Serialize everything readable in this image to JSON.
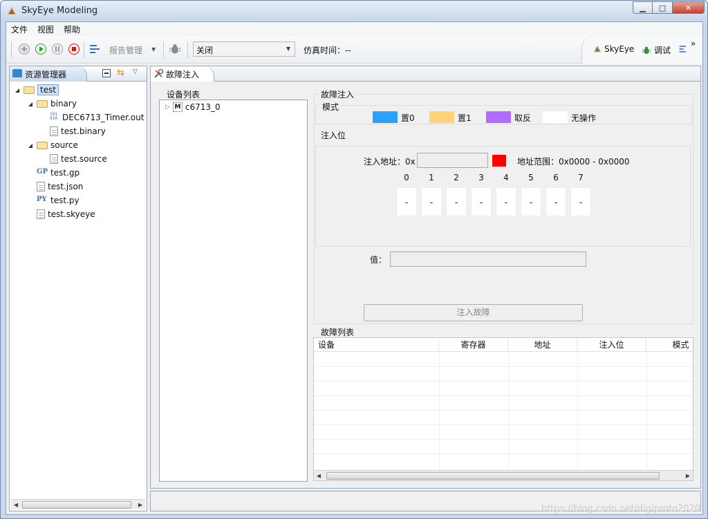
{
  "window": {
    "title": "SkyEye Modeling",
    "buttons": {
      "minimize": "▁",
      "maximize": "□",
      "close": "✕"
    }
  },
  "menu": [
    "文件",
    "视图",
    "帮助"
  ],
  "toolbar": {
    "report_label": "报告管理",
    "combo_value": "关闭",
    "sim_time_label": "仿真时间：--",
    "perspectives": {
      "skyeye": "SkyEye",
      "debug": "调试",
      "more": "»"
    }
  },
  "explorer": {
    "tab_label": "资源管理器",
    "tree": [
      {
        "label": "test",
        "depth": 0,
        "twisty": "◢",
        "icon": "folder-open-icon"
      },
      {
        "label": "binary",
        "depth": 1,
        "twisty": "◢",
        "icon": "folder-open-icon"
      },
      {
        "label": "DEC6713_Timer.out",
        "depth": 2,
        "twisty": "",
        "icon": "binary-file-icon"
      },
      {
        "label": "test.binary",
        "depth": 2,
        "twisty": "",
        "icon": "file-icon"
      },
      {
        "label": "source",
        "depth": 1,
        "twisty": "◢",
        "icon": "folder-open-icon"
      },
      {
        "label": "test.source",
        "depth": 2,
        "twisty": "",
        "icon": "file-icon"
      },
      {
        "label": "test.gp",
        "depth": 1,
        "twisty": "",
        "icon": "gp-file-icon"
      },
      {
        "label": "test.json",
        "depth": 1,
        "twisty": "",
        "icon": "file-icon"
      },
      {
        "label": "test.py",
        "depth": 1,
        "twisty": "",
        "icon": "python-file-icon"
      },
      {
        "label": "test.skyeye",
        "depth": 1,
        "twisty": "",
        "icon": "file-icon"
      }
    ]
  },
  "editor": {
    "tab_label": "故障注入",
    "device_list": {
      "title": "设备列表",
      "items": [
        {
          "label": "c6713_0",
          "twisty": "▷"
        }
      ]
    },
    "fault_injection": {
      "title": "故障注入",
      "mode": {
        "title": "模式",
        "options": [
          {
            "label": "置0",
            "color": "#2aa1ff"
          },
          {
            "label": "置1",
            "color": "#ffd37a"
          },
          {
            "label": "取反",
            "color": "#b26bff"
          },
          {
            "label": "无操作",
            "color": "#ffffff"
          }
        ]
      },
      "inject_bits": {
        "title": "注入位",
        "address_label": "注入地址：0x",
        "address_value": "",
        "address_range": "地址范围：0x0000 - 0x0000",
        "indicator_color": "#ff0000",
        "bits": [
          {
            "num": "0",
            "val": "-"
          },
          {
            "num": "1",
            "val": "-"
          },
          {
            "num": "2",
            "val": "-"
          },
          {
            "num": "3",
            "val": "-"
          },
          {
            "num": "4",
            "val": "-"
          },
          {
            "num": "5",
            "val": "-"
          },
          {
            "num": "6",
            "val": "-"
          },
          {
            "num": "7",
            "val": "-"
          }
        ]
      },
      "value_label": "值：",
      "value": "",
      "inject_button": "注入故障"
    },
    "fault_list": {
      "title": "故障列表",
      "columns": [
        "设备",
        "寄存器",
        "地址",
        "注入位",
        "模式"
      ],
      "rows": []
    }
  },
  "watermark": "https://blog.csdn.net/digiproto2020"
}
